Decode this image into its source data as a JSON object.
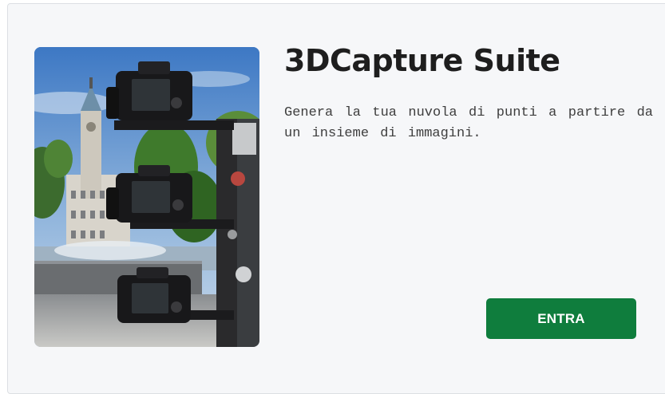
{
  "card": {
    "title": "3DCapture Suite",
    "description": "Genera la tua nuvola di punti a partire da un insieme di immagini.",
    "image_subject": "camera-rig-photo",
    "enter_label": "ENTRA"
  },
  "colors": {
    "card_background": "#f6f7f9",
    "card_border": "#dcdfe3",
    "title": "#1e1e1e",
    "description": "#3e3e3e",
    "button_background": "#0f7d3d",
    "button_text": "#ffffff"
  }
}
